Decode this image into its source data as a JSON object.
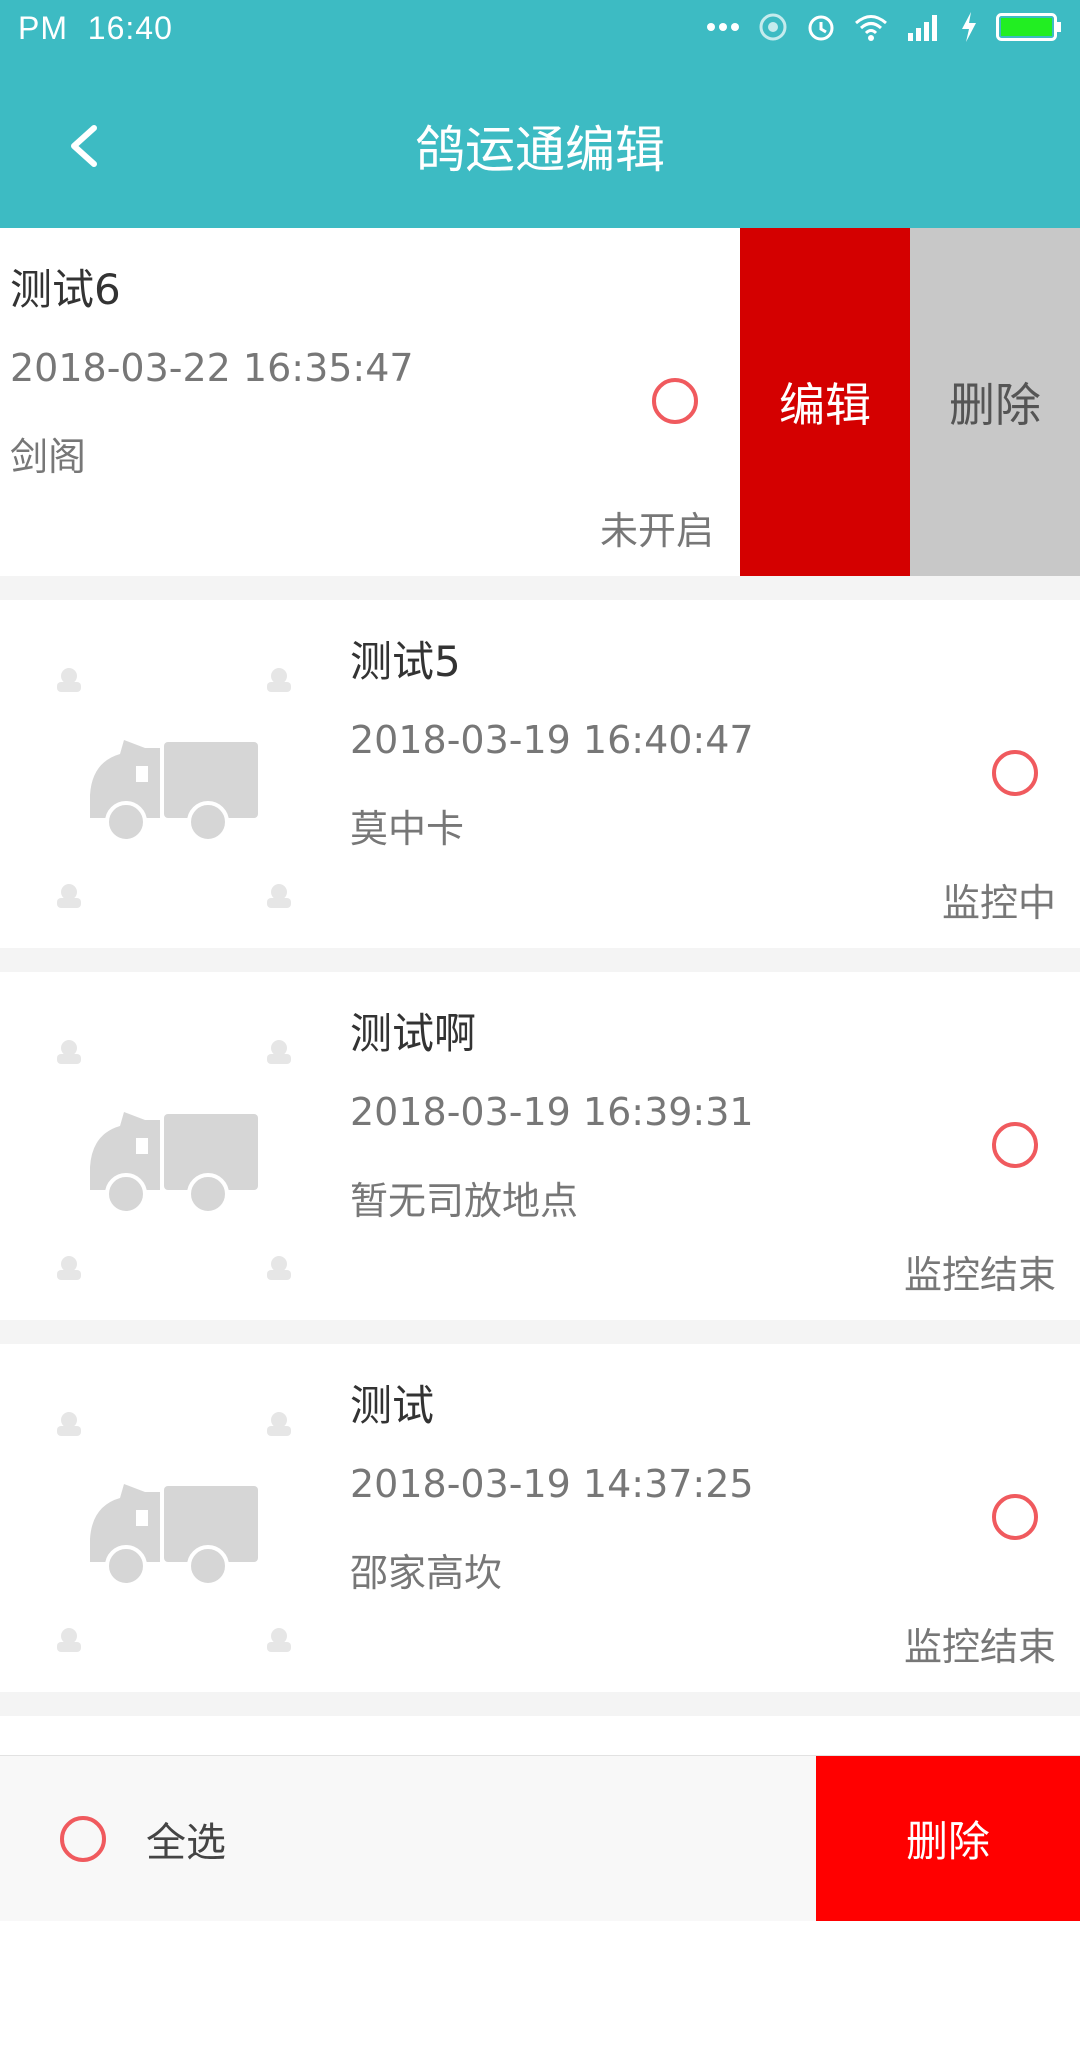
{
  "status_bar": {
    "ampm": "PM",
    "time": "16:40"
  },
  "header": {
    "title": "鸽运通编辑"
  },
  "items": [
    {
      "name": "测试6",
      "date": "2018-03-22 16:35:47",
      "place": "剑阁",
      "status": "未开启",
      "swiped": true,
      "edit_label": "编辑",
      "delete_label": "删除"
    },
    {
      "name": "测试5",
      "date": "2018-03-19 16:40:47",
      "place": "莫中卡",
      "status": "监控中"
    },
    {
      "name": "测试啊",
      "date": "2018-03-19 16:39:31",
      "place": "暂无司放地点",
      "status": "监控结束"
    },
    {
      "name": "测试",
      "date": "2018-03-19 14:37:25",
      "place": "邵家高坎",
      "status": "监控结束"
    }
  ],
  "bottom_bar": {
    "select_all_label": "全选",
    "delete_label": "删除"
  },
  "colors": {
    "teal": "#3dbbc3",
    "edit_red": "#d40000",
    "delete_red": "#ff0000",
    "radio_red": "#f05a5e"
  }
}
